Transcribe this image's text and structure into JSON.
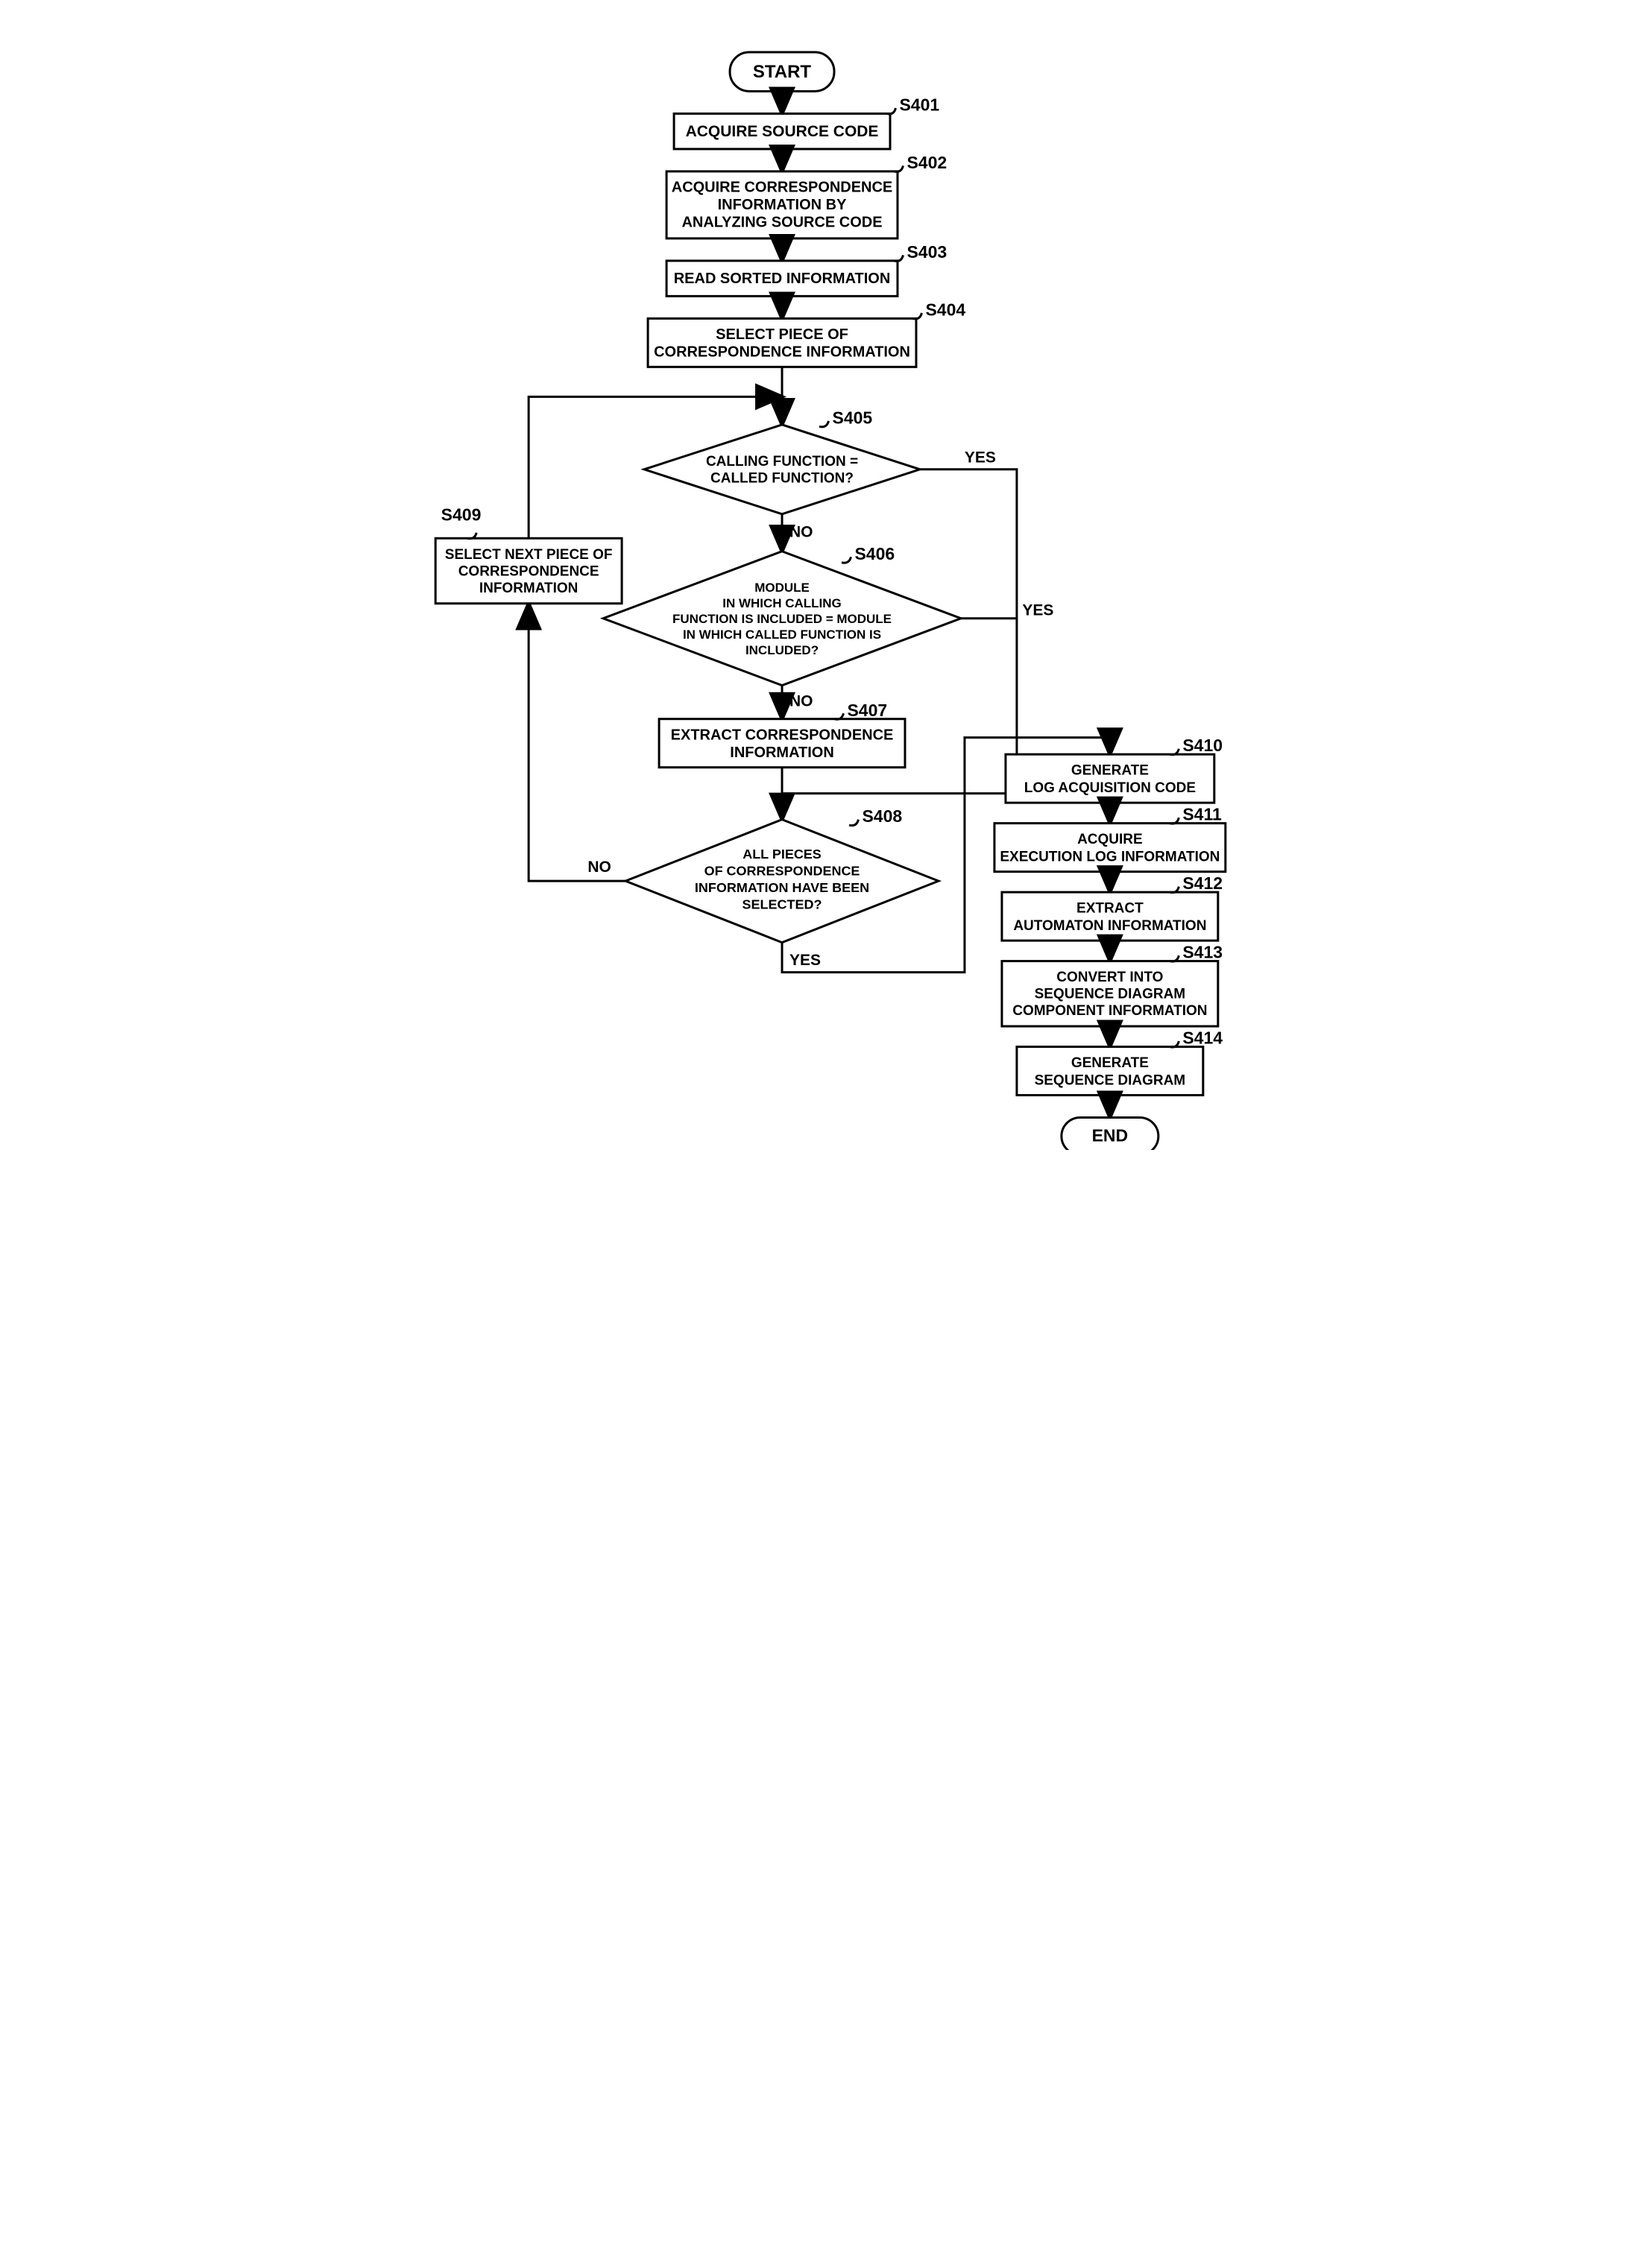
{
  "chart_data": {
    "type": "flowchart",
    "nodes": [
      {
        "id": "start",
        "kind": "terminal",
        "text": "START"
      },
      {
        "id": "s401",
        "kind": "process",
        "step": "S401",
        "text": "ACQUIRE SOURCE CODE"
      },
      {
        "id": "s402",
        "kind": "process",
        "step": "S402",
        "text": "ACQUIRE CORRESPONDENCE INFORMATION BY ANALYZING SOURCE CODE"
      },
      {
        "id": "s403",
        "kind": "process",
        "step": "S403",
        "text": "READ SORTED INFORMATION"
      },
      {
        "id": "s404",
        "kind": "process",
        "step": "S404",
        "text": "SELECT PIECE OF CORRESPONDENCE INFORMATION"
      },
      {
        "id": "s405",
        "kind": "decision",
        "step": "S405",
        "text": "CALLING FUNCTION = CALLED FUNCTION?"
      },
      {
        "id": "s406",
        "kind": "decision",
        "step": "S406",
        "text": "MODULE IN WHICH CALLING FUNCTION IS INCLUDED = MODULE IN WHICH CALLED FUNCTION IS INCLUDED?"
      },
      {
        "id": "s407",
        "kind": "process",
        "step": "S407",
        "text": "EXTRACT CORRESPONDENCE INFORMATION"
      },
      {
        "id": "s408",
        "kind": "decision",
        "step": "S408",
        "text": "ALL PIECES OF CORRESPONDENCE INFORMATION HAVE BEEN SELECTED?"
      },
      {
        "id": "s409",
        "kind": "process",
        "step": "S409",
        "text": "SELECT NEXT PIECE OF CORRESPONDENCE INFORMATION"
      },
      {
        "id": "s410",
        "kind": "process",
        "step": "S410",
        "text": "GENERATE LOG ACQUISITION CODE"
      },
      {
        "id": "s411",
        "kind": "process",
        "step": "S411",
        "text": "ACQUIRE EXECUTION LOG INFORMATION"
      },
      {
        "id": "s412",
        "kind": "process",
        "step": "S412",
        "text": "EXTRACT AUTOMATON INFORMATION"
      },
      {
        "id": "s413",
        "kind": "process",
        "step": "S413",
        "text": "CONVERT INTO SEQUENCE DIAGRAM COMPONENT INFORMATION"
      },
      {
        "id": "s414",
        "kind": "process",
        "step": "S414",
        "text": "GENERATE SEQUENCE DIAGRAM"
      },
      {
        "id": "end",
        "kind": "terminal",
        "text": "END"
      }
    ],
    "edges": [
      {
        "from": "start",
        "to": "s401"
      },
      {
        "from": "s401",
        "to": "s402"
      },
      {
        "from": "s402",
        "to": "s403"
      },
      {
        "from": "s403",
        "to": "s404"
      },
      {
        "from": "s404",
        "to": "s405"
      },
      {
        "from": "s405",
        "to": "s406",
        "label": "NO"
      },
      {
        "from": "s405",
        "to": "s408",
        "label": "YES"
      },
      {
        "from": "s406",
        "to": "s407",
        "label": "NO"
      },
      {
        "from": "s406",
        "to": "s408",
        "label": "YES"
      },
      {
        "from": "s407",
        "to": "s408"
      },
      {
        "from": "s408",
        "to": "s409",
        "label": "NO"
      },
      {
        "from": "s409",
        "to": "s405"
      },
      {
        "from": "s408",
        "to": "s410",
        "label": "YES"
      },
      {
        "from": "s410",
        "to": "s411"
      },
      {
        "from": "s411",
        "to": "s412"
      },
      {
        "from": "s412",
        "to": "s413"
      },
      {
        "from": "s413",
        "to": "s414"
      },
      {
        "from": "s414",
        "to": "end"
      }
    ]
  },
  "labels": {
    "yes": "YES",
    "no": "NO",
    "tick": "S"
  },
  "steps": {
    "start": "START",
    "end": "END",
    "s401": {
      "tag": "S401",
      "l1": "ACQUIRE SOURCE CODE"
    },
    "s402": {
      "tag": "S402",
      "l1": "ACQUIRE CORRESPONDENCE",
      "l2": "INFORMATION BY",
      "l3": "ANALYZING SOURCE CODE"
    },
    "s403": {
      "tag": "S403",
      "l1": "READ SORTED INFORMATION"
    },
    "s404": {
      "tag": "S404",
      "l1": "SELECT PIECE OF",
      "l2": "CORRESPONDENCE INFORMATION"
    },
    "s405": {
      "tag": "S405",
      "l1": "CALLING FUNCTION =",
      "l2": "CALLED FUNCTION?"
    },
    "s406": {
      "tag": "S406",
      "l1": "MODULE",
      "l2": "IN WHICH CALLING",
      "l3": "FUNCTION IS INCLUDED = MODULE",
      "l4": "IN WHICH CALLED FUNCTION IS",
      "l5": "INCLUDED?"
    },
    "s407": {
      "tag": "S407",
      "l1": "EXTRACT CORRESPONDENCE",
      "l2": "INFORMATION"
    },
    "s408": {
      "tag": "S408",
      "l1": "ALL PIECES",
      "l2": "OF CORRESPONDENCE",
      "l3": "INFORMATION HAVE BEEN",
      "l4": "SELECTED?"
    },
    "s409": {
      "tag": "S409",
      "l1": "SELECT NEXT PIECE OF",
      "l2": "CORRESPONDENCE",
      "l3": "INFORMATION"
    },
    "s410": {
      "tag": "S410",
      "l1": "GENERATE",
      "l2": "LOG ACQUISITION CODE"
    },
    "s411": {
      "tag": "S411",
      "l1": "ACQUIRE",
      "l2": "EXECUTION LOG INFORMATION"
    },
    "s412": {
      "tag": "S412",
      "l1": "EXTRACT",
      "l2": "AUTOMATON INFORMATION"
    },
    "s413": {
      "tag": "S413",
      "l1": "CONVERT INTO",
      "l2": "SEQUENCE DIAGRAM",
      "l3": "COMPONENT INFORMATION"
    },
    "s414": {
      "tag": "S414",
      "l1": "GENERATE",
      "l2": "SEQUENCE DIAGRAM"
    }
  }
}
